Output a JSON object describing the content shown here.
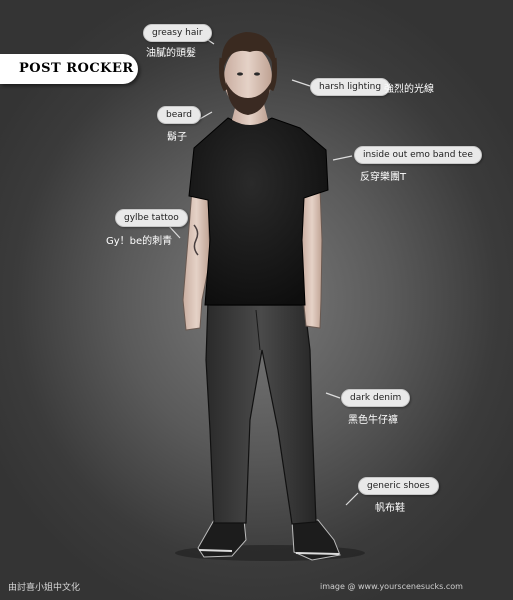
{
  "title": "POST ROCKER",
  "callouts": [
    {
      "en": "greasy hair",
      "cn": "油膩的頭髮"
    },
    {
      "en": "harsh lighting",
      "cn": "強烈的光線"
    },
    {
      "en": "beard",
      "cn": "鬍子"
    },
    {
      "en": "inside out emo band tee",
      "cn": "反穿樂團T"
    },
    {
      "en": "gylbe tattoo",
      "cn": "Gy！be的刺青"
    },
    {
      "en": "dark denim",
      "cn": "黑色牛仔褲"
    },
    {
      "en": "generic shoes",
      "cn": "帆布鞋"
    }
  ],
  "footer": {
    "translator": "由討喜小姐中文化",
    "credit": "image @ www.yourscenesucks.com"
  },
  "colors": {
    "background": "#4a4a4a",
    "bubble": "#e9e9e9",
    "shirt": "#141414",
    "jeans": "#2e2e2e",
    "skin": "#d9c3b6"
  }
}
